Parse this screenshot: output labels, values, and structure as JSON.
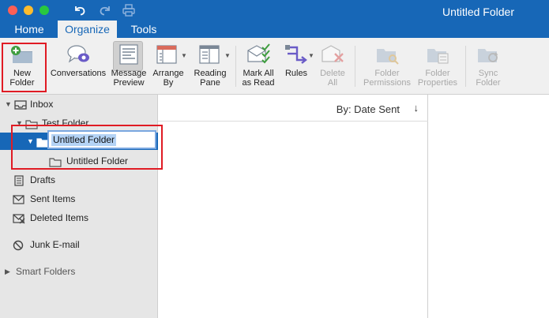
{
  "window": {
    "title": "Untitled Folder"
  },
  "tabs": [
    {
      "label": "Home"
    },
    {
      "label": "Organize"
    },
    {
      "label": "Tools"
    }
  ],
  "quick_access": [
    "undo-icon",
    "redo-icon",
    "print-icon"
  ],
  "ribbon": {
    "new_folder": {
      "line1": "New",
      "line2": "Folder"
    },
    "conversations": {
      "line1": "Conversations"
    },
    "message_preview": {
      "line1": "Message",
      "line2": "Preview"
    },
    "arrange_by": {
      "line1": "Arrange",
      "line2": "By"
    },
    "reading_pane": {
      "line1": "Reading",
      "line2": "Pane"
    },
    "mark_all_read": {
      "line1": "Mark All",
      "line2": "as Read"
    },
    "rules": {
      "line1": "Rules"
    },
    "delete_all": {
      "line1": "Delete",
      "line2": "All"
    },
    "folder_permissions": {
      "line1": "Folder",
      "line2": "Permissions"
    },
    "folder_properties": {
      "line1": "Folder",
      "line2": "Properties"
    },
    "sync_folder": {
      "line1": "Sync",
      "line2": "Folder"
    }
  },
  "sidebar": {
    "inbox": "Inbox",
    "test_folder": "Test Folder",
    "editing_folder": "Untitled Folder",
    "child_folder": "Untitled Folder",
    "drafts": "Drafts",
    "sent": "Sent Items",
    "deleted": "Deleted Items",
    "junk": "Junk E-mail",
    "smart": "Smart Folders"
  },
  "message_list": {
    "sort_label": "By: Date Sent",
    "sort_direction": "↓"
  },
  "colors": {
    "accent": "#1767b7",
    "highlight": "#e01b24",
    "sidebar_bg": "#e6e6e6"
  }
}
